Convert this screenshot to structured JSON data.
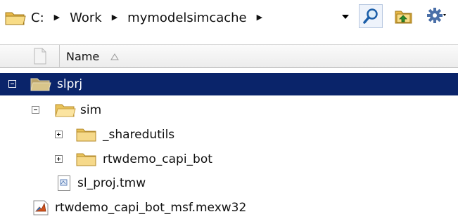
{
  "address_bar": {
    "crumbs": [
      "C:",
      "Work",
      "mymodelsimcache"
    ]
  },
  "header": {
    "name_label": "Name"
  },
  "tree": [
    {
      "label": "slprj",
      "icon": "folder-open-icon",
      "expander": "collapse",
      "selected": true
    },
    {
      "label": "sim",
      "icon": "folder-open-icon",
      "expander": "collapse",
      "selected": false
    },
    {
      "label": "_sharedutils",
      "icon": "folder-icon",
      "expander": "expand",
      "selected": false
    },
    {
      "label": "rtwdemo_capi_bot",
      "icon": "folder-icon",
      "expander": "expand",
      "selected": false
    },
    {
      "label": "sl_proj.tmw",
      "icon": "document-icon",
      "expander": "none",
      "selected": false
    },
    {
      "label": "rtwdemo_capi_bot_msf.mexw32",
      "icon": "matlab-file-icon",
      "expander": "none",
      "selected": false
    }
  ],
  "colors": {
    "selection": "#0a246a",
    "folder": "#f4d57e"
  }
}
